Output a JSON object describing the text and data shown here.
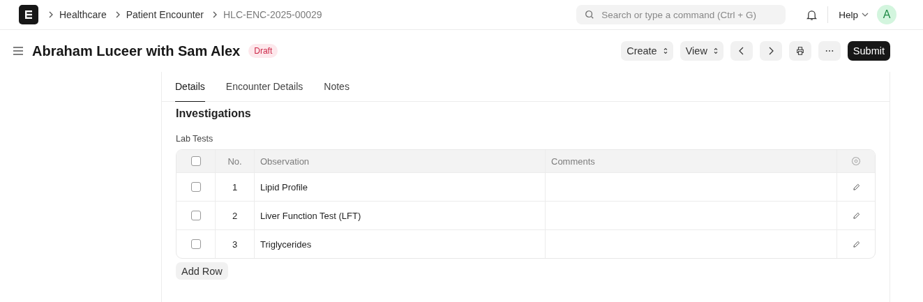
{
  "breadcrumbs": [
    {
      "label": "Healthcare",
      "current": false
    },
    {
      "label": "Patient Encounter",
      "current": false
    },
    {
      "label": "HLC-ENC-2025-00029",
      "current": true
    }
  ],
  "search": {
    "placeholder": "Search or type a command (Ctrl + G)"
  },
  "help": "Help",
  "avatar": "A",
  "title": "Abraham Luceer with Sam Alex",
  "status": "Draft",
  "actions": {
    "create": "Create",
    "view": "View",
    "submit": "Submit"
  },
  "tabs": [
    {
      "label": "Details",
      "selected": true
    },
    {
      "label": "Encounter Details",
      "selected": false
    },
    {
      "label": "Notes",
      "selected": false
    }
  ],
  "section": "Investigations",
  "table": {
    "label": "Lab Tests",
    "columns": [
      "No.",
      "Observation",
      "Comments"
    ],
    "all_checked": false,
    "rows": [
      {
        "no": "1",
        "observation": "Lipid Profile",
        "checked": false
      },
      {
        "no": "2",
        "observation": "Liver Function Test (LFT)",
        "checked": false
      },
      {
        "no": "3",
        "observation": "Triglycerides",
        "checked": false
      }
    ]
  },
  "add_row": "Add Row"
}
